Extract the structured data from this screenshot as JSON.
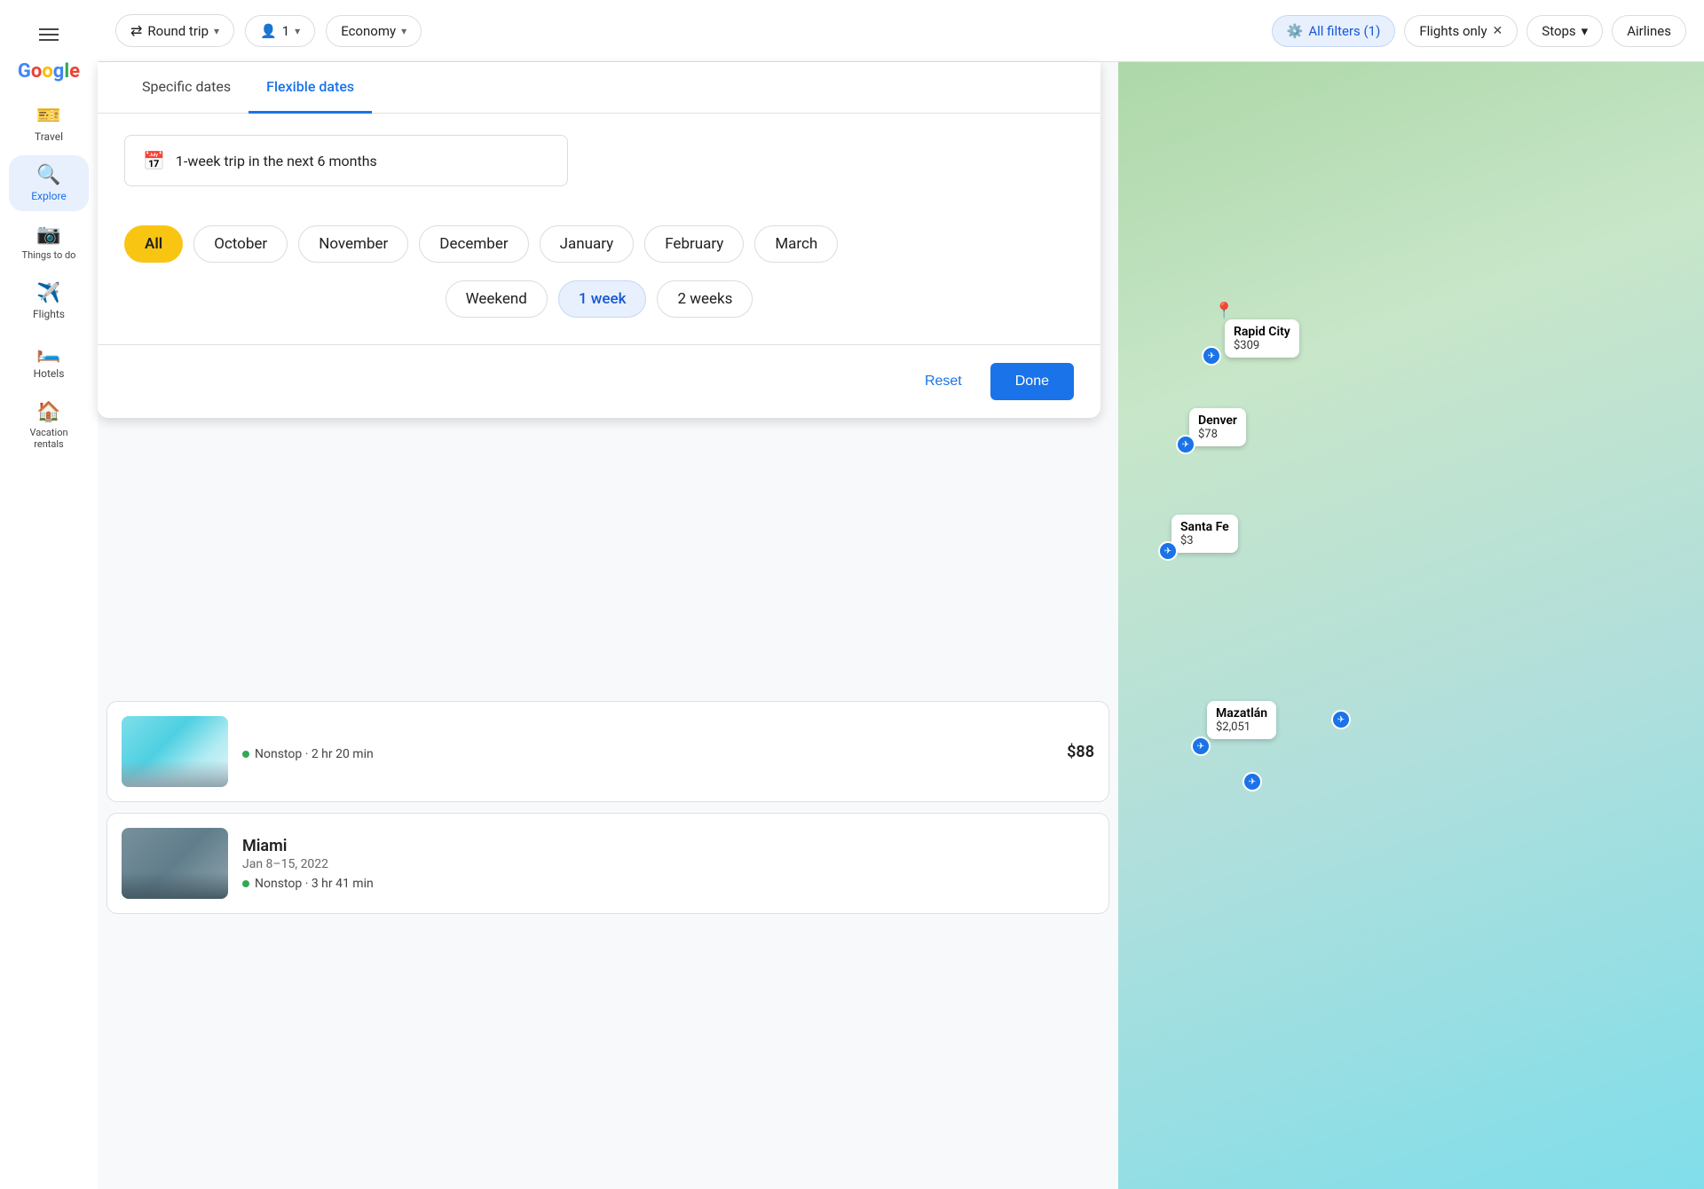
{
  "sidebar": {
    "items": [
      {
        "id": "travel",
        "label": "Travel",
        "icon": "🎫",
        "active": false
      },
      {
        "id": "explore",
        "label": "Explore",
        "icon": "🔍",
        "active": true
      },
      {
        "id": "things-to-do",
        "label": "Things to do",
        "icon": "📷",
        "active": false
      },
      {
        "id": "flights",
        "label": "Flights",
        "icon": "✈️",
        "active": false
      },
      {
        "id": "hotels",
        "label": "Hotels",
        "icon": "🛏️",
        "active": false
      },
      {
        "id": "vacation-rentals",
        "label": "Vacation rentals",
        "icon": "🏠",
        "active": false
      }
    ]
  },
  "topbar": {
    "round_trip_label": "Round trip",
    "passengers_label": "1",
    "economy_label": "Economy",
    "all_filters_label": "All filters (1)",
    "flights_only_label": "Flights only",
    "stops_label": "Stops",
    "airlines_label": "Airlines"
  },
  "date_modal": {
    "tab_specific": "Specific dates",
    "tab_flexible": "Flexible dates",
    "trip_input_value": "1-week trip in the next 6 months",
    "months": [
      {
        "id": "all",
        "label": "All",
        "selected": "all"
      },
      {
        "id": "october",
        "label": "October",
        "selected": false
      },
      {
        "id": "november",
        "label": "November",
        "selected": false
      },
      {
        "id": "december",
        "label": "December",
        "selected": false
      },
      {
        "id": "january",
        "label": "January",
        "selected": false
      },
      {
        "id": "february",
        "label": "February",
        "selected": false
      },
      {
        "id": "march",
        "label": "March",
        "selected": false
      }
    ],
    "durations": [
      {
        "id": "weekend",
        "label": "Weekend",
        "selected": false
      },
      {
        "id": "1week",
        "label": "1 week",
        "selected": true
      },
      {
        "id": "2weeks",
        "label": "2 weeks",
        "selected": false
      }
    ],
    "reset_label": "Reset",
    "done_label": "Done"
  },
  "map": {
    "labels": [
      {
        "city": "Rapid City",
        "price": "$309",
        "top": "360",
        "left": "120"
      },
      {
        "city": "Denver",
        "price": "$78",
        "top": "460",
        "left": "80"
      },
      {
        "city": "Santa Fe",
        "price": "$3",
        "top": "580",
        "left": "60"
      },
      {
        "city": "Mazatlán",
        "price": "$2,051",
        "top": "780",
        "left": "100"
      }
    ]
  },
  "results": [
    {
      "type": "beach",
      "destination": "",
      "flight_info": "Nonstop · 2 hr 20 min",
      "price": "$88"
    },
    {
      "type": "city",
      "destination": "Miami",
      "dates": "Jan 8–15, 2022",
      "flight_info": "Nonstop · 3 hr 41 min",
      "price": ""
    }
  ]
}
